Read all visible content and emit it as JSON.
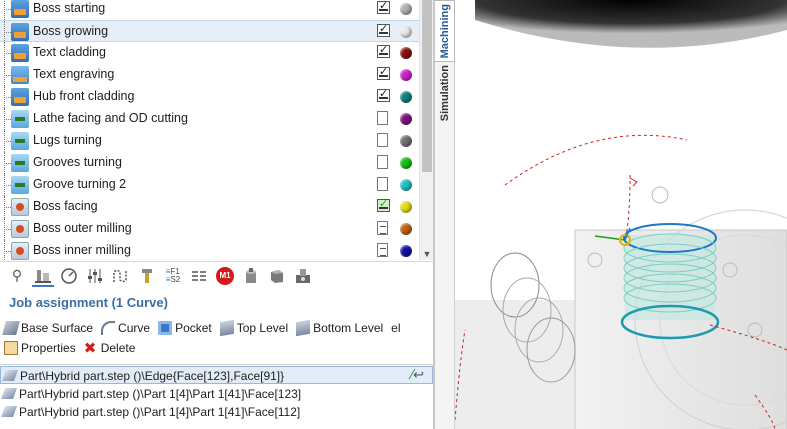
{
  "operations": [
    {
      "label": "Boss starting",
      "icon": "mill-icon",
      "status": "calculated",
      "color": "#b0b0b0"
    },
    {
      "label": "Boss growing",
      "icon": "mill-icon",
      "status": "calculated",
      "color": "#e8e8e8",
      "selected": true
    },
    {
      "label": "Text cladding",
      "icon": "mill-icon",
      "status": "calculated",
      "color": "#8a1010"
    },
    {
      "label": "Text engraving",
      "icon": "engrave-icon",
      "status": "calculated",
      "color": "#d020d0"
    },
    {
      "label": "Hub front cladding",
      "icon": "mill-icon",
      "status": "calculated",
      "color": "#108080"
    },
    {
      "label": "Lathe facing and OD cutting",
      "icon": "turn-icon",
      "status": "not-calculated",
      "color": "#801080"
    },
    {
      "label": "Lugs turning",
      "icon": "turn-icon",
      "status": "not-calculated",
      "color": "#707070"
    },
    {
      "label": "Grooves turning",
      "icon": "turn-icon",
      "status": "not-calculated",
      "color": "#10c010"
    },
    {
      "label": "Groove turning 2",
      "icon": "turn-icon",
      "status": "not-calculated",
      "color": "#20c0c8"
    },
    {
      "label": "Boss facing",
      "icon": "face-icon",
      "status": "calculated-ok",
      "color": "#e0e010"
    },
    {
      "label": "Boss outer milling",
      "icon": "face-icon",
      "status": "document",
      "color": "#c06010"
    },
    {
      "label": "Boss inner milling",
      "icon": "face-icon",
      "status": "document",
      "color": "#1010a0"
    }
  ],
  "toolbar_icons": [
    "probe-icon",
    "part-icon",
    "gauge-icon",
    "sliders-icon",
    "path-icon",
    "tool-icon",
    "f1-s2-icon",
    "rows-icon",
    "m1-icon",
    "cylinder-icon",
    "cube-icon",
    "machine-icon"
  ],
  "toolbar_text": {
    "f1s2_top": "F1",
    "f1s2_bottom": "S2",
    "m1": "M1"
  },
  "job": {
    "title": "Job assignment  (1 Curve)",
    "commands_row1": [
      {
        "label": "Base Surface",
        "icon": "base-surface-icon"
      },
      {
        "label": "Curve",
        "icon": "curve-icon"
      },
      {
        "label": "Pocket",
        "icon": "pocket-icon"
      },
      {
        "label": "Top Level",
        "icon": "top-level-icon"
      },
      {
        "label": "Bottom Level",
        "icon": "bottom-level-icon"
      },
      {
        "label": "el",
        "icon": ""
      }
    ],
    "commands_row2": [
      {
        "label": "Properties",
        "icon": "properties-icon"
      },
      {
        "label": "Delete",
        "icon": "delete-icon"
      }
    ],
    "geometry": [
      "Part\\Hybrid part.step ()\\Edge{Face[123],Face[91]}",
      "Part\\Hybrid part.step ()\\Part 1[4]\\Part 1[41]\\Face[123]",
      "Part\\Hybrid part.step ()\\Part 1[4]\\Part 1[41]\\Face[112]"
    ]
  },
  "side_tabs": {
    "machining": "Machining",
    "simulation": "Simulation"
  },
  "colors": {
    "accent": "#3a6ea5",
    "selection": "#e6eef8",
    "toolpath": "#1e78c8",
    "reference": "#d02020"
  }
}
